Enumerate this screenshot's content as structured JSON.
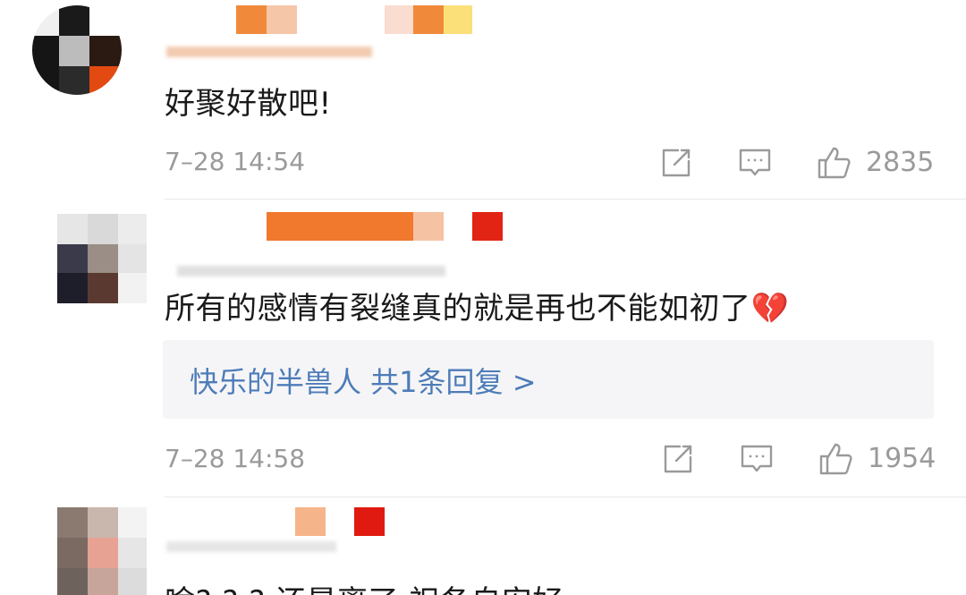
{
  "comments": [
    {
      "text": "好聚好散吧!",
      "time": "7–28 14:54",
      "likes": "2835"
    },
    {
      "text": "所有的感情有裂缝真的就是再也不能如初了💔",
      "reply_link": "快乐的半兽人  共1条回复 >",
      "time": "7–28 14:58",
      "likes": "1954"
    },
    {
      "text": "啥? ? ? 还是离了 祝各自安好"
    }
  ],
  "icons": {
    "repost": "repost-icon",
    "comment": "comment-icon",
    "like": "thumbs-up-icon"
  },
  "colors": {
    "meta_gray": "#9a9a9a",
    "reply_link": "#4d7cb8",
    "reply_bg": "#f5f5f7"
  }
}
